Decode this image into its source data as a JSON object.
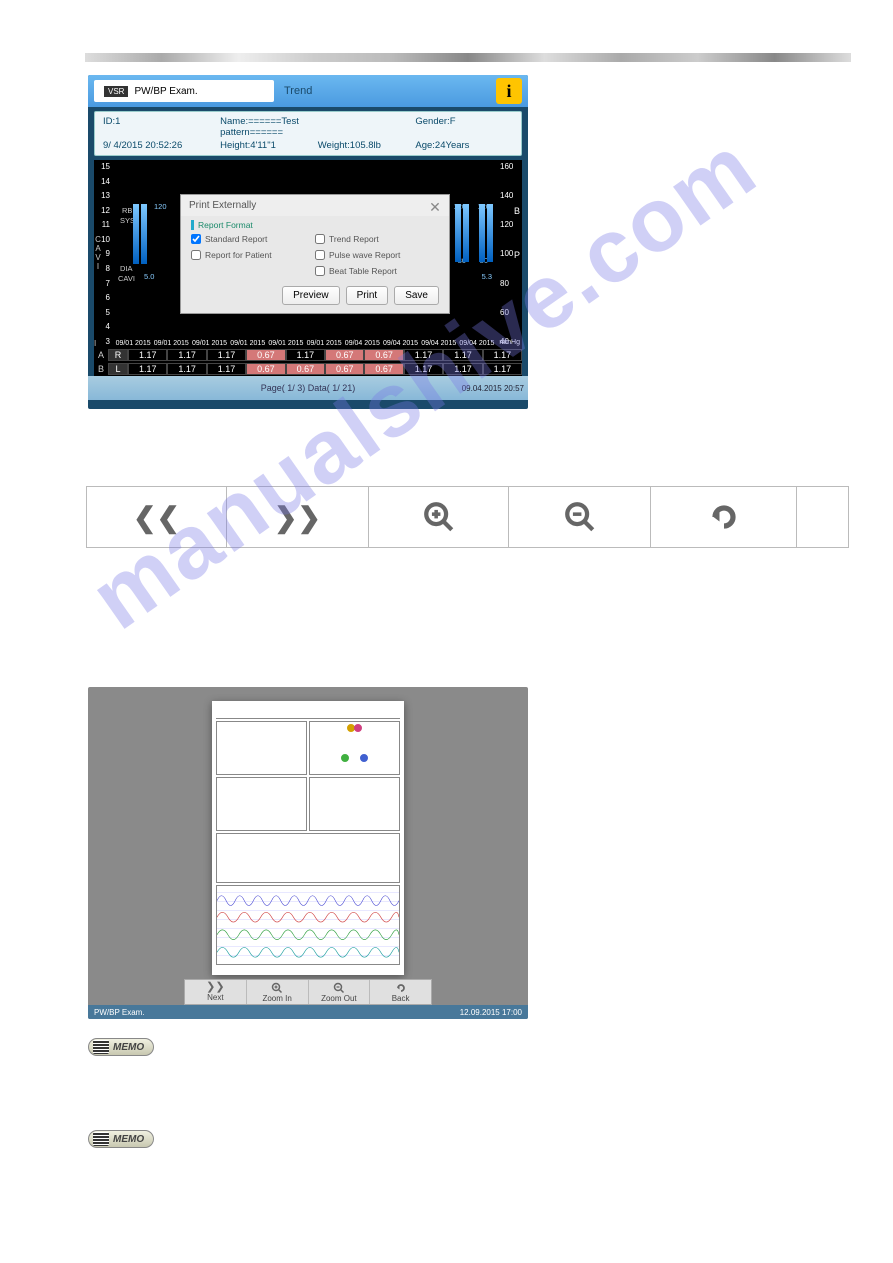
{
  "stripe": "gradient",
  "watermark": "manualshive.com",
  "screenshot1": {
    "exam_badge": "VSR",
    "exam_label": "PW/BP Exam.",
    "trend": "Trend",
    "info": "i",
    "patient": {
      "id_label": "ID:1",
      "name_label": "Name:======Test pattern======",
      "gender_label": "Gender:F",
      "date": "9/ 4/2015 20:52:26",
      "height": "Height:4'11\"1",
      "weight": "Weight:105.8lb",
      "age": "Age:24Years"
    },
    "left_ticks": [
      "15",
      "14",
      "13",
      "12",
      "11",
      "10",
      "9",
      "8",
      "7",
      "6",
      "5",
      "4",
      "3"
    ],
    "right_ticks": [
      "160",
      "140",
      "120",
      "100",
      "80",
      "60",
      "40"
    ],
    "right_unit_top": "B",
    "right_unit_mid": "P",
    "right_unit_bot": "mmHg",
    "side_RB": "RB",
    "side_SYS": "SYS",
    "side_DIA": "DIA",
    "side_CAVI": "CAVI",
    "side_cavi_axis": "C\nA\nV\nI",
    "cavi_val": "5.0",
    "sys_val": "120",
    "dia_val": "80",
    "dia_val2": "5.3",
    "dates": [
      "09/01 2015",
      "09/01 2015",
      "09/01 2015",
      "09/01 2015",
      "09/01 2015",
      "09/01 2015",
      "09/04 2015",
      "09/04 2015",
      "09/04 2015",
      "09/04 2015"
    ],
    "dialog": {
      "title": "Print Externally",
      "section": "Report Format",
      "checks": {
        "standard": "Standard Report",
        "trend": "Trend Report",
        "patient": "Report for Patient",
        "pulse": "Pulse wave Report",
        "beat": "Beat Table Report"
      },
      "preview": "Preview",
      "print": "Print",
      "save": "Save",
      "close": "✕"
    },
    "abi": {
      "side_label_a": "A",
      "side_label_b": "B",
      "side_label_i": "I",
      "rows": [
        {
          "rl": "R",
          "cells": [
            "1.17",
            "1.17",
            "1.17",
            "0.67",
            "1.17",
            "0.67",
            "0.67",
            "1.17",
            "1.17",
            "1.17"
          ],
          "pink": [
            false,
            false,
            false,
            true,
            false,
            true,
            true,
            false,
            false,
            false
          ]
        },
        {
          "rl": "L",
          "cells": [
            "1.17",
            "1.17",
            "1.17",
            "0.67",
            "0.67",
            "0.67",
            "0.67",
            "1.17",
            "1.17",
            "1.17"
          ],
          "pink": [
            false,
            false,
            false,
            true,
            true,
            true,
            true,
            false,
            false,
            false
          ]
        }
      ]
    },
    "footer": "Page(  1/  3) Data(  1/  21)",
    "footer_ts": "09.04.2015 20:57"
  },
  "toolbar": {
    "prev": "❮❮",
    "next": "❯❯",
    "zoom_in": "⊕",
    "zoom_out": "⊖",
    "back": "↶"
  },
  "screenshot2": {
    "buttons": {
      "next_ic": "❯❯",
      "next": "Next",
      "zin_ic": "⊕",
      "zin": "Zoom In",
      "zout_ic": "⊖",
      "zout": "Zoom Out",
      "back_ic": "↶",
      "back": "Back"
    },
    "footer_exam": "PW/BP Exam.",
    "footer_ts": "12.09.2015 17:00"
  },
  "memo": "MEMO"
}
